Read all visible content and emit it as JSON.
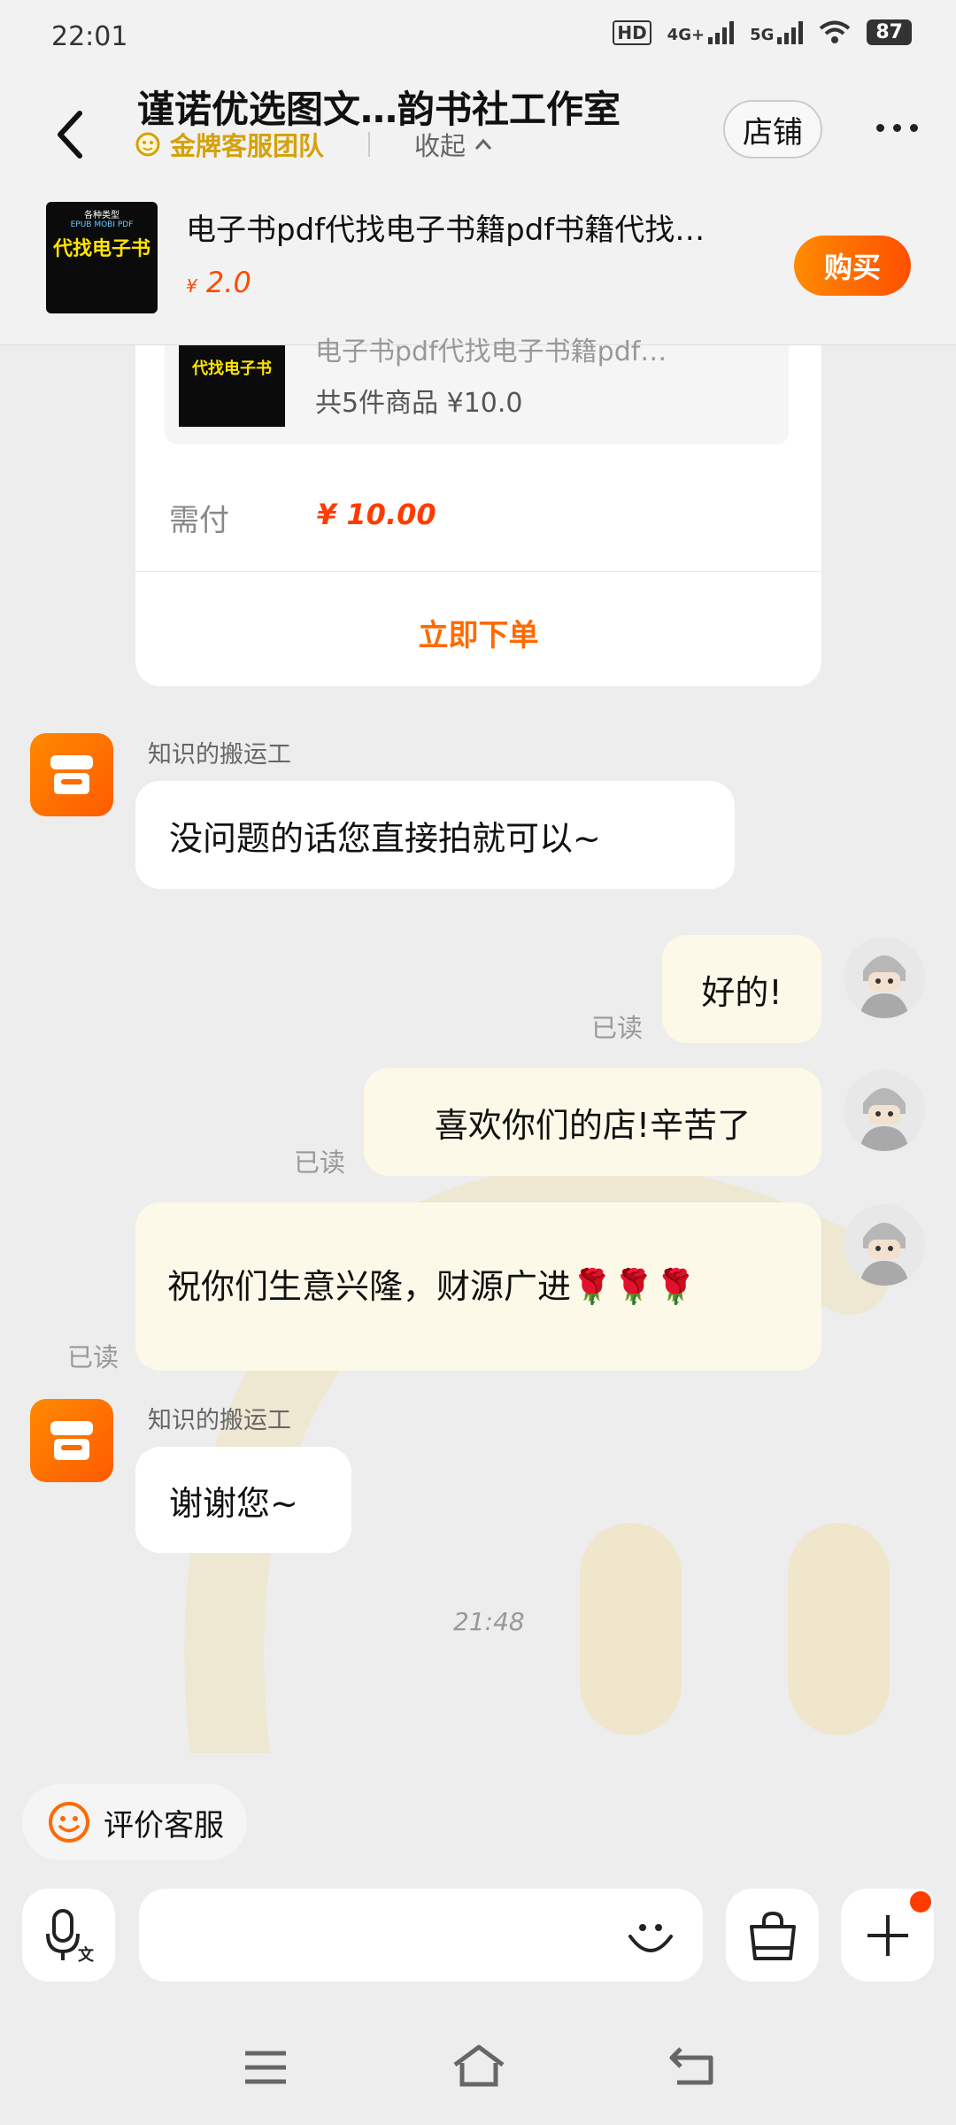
{
  "status_bar": {
    "time": "22:01",
    "hd": "HD",
    "net1": "4G+",
    "net2": "5G",
    "battery": "87"
  },
  "header": {
    "title": "谨诺优选图文…韵书社工作室",
    "team_label": "金牌客服团队",
    "collapse_label": "收起",
    "shop_button": "店铺",
    "product": {
      "image_text_top": "各种类型",
      "image_text_main": "代找电子书",
      "image_text_sub": "EPUB MOBI PDF",
      "title": "电子书pdf代找电子书籍pdf书籍代找…",
      "currency": "¥",
      "price": "2.0",
      "buy_button": "购买"
    }
  },
  "order_card": {
    "thumb_text": "代找电子书",
    "item_title": "电子书pdf代找电子书籍pdf…",
    "item_meta": "共5件商品  ¥10.0",
    "need_label": "需付",
    "need_value": "¥ 10.00",
    "submit_button": "立即下单"
  },
  "messages": [
    {
      "sender": "知识的搬运工",
      "text": "没问题的话您直接拍就可以~"
    },
    {
      "text": "好的!",
      "read": "已读"
    },
    {
      "text": "喜欢你们的店!辛苦了",
      "read": "已读"
    },
    {
      "text": "祝你们生意兴隆，财源广进🌹🌹🌹",
      "read": "已读"
    },
    {
      "sender": "知识的搬运工",
      "text": "谢谢您~"
    }
  ],
  "timestamp": "21:48",
  "rate_button": "评价客服",
  "icons": {
    "back": "back-arrow-icon",
    "more": "more-dots-icon",
    "voice": "voice-input-icon",
    "emoji": "emoji-icon",
    "bag": "shopping-bag-icon",
    "plus": "plus-icon",
    "nav_menu": "menu-icon",
    "nav_home": "home-icon",
    "nav_back": "nav-back-icon"
  },
  "colors": {
    "accent": "#ff6a00",
    "price": "#ff3b00",
    "gold": "#d4a20a",
    "my_bubble": "#fdf9e8"
  }
}
